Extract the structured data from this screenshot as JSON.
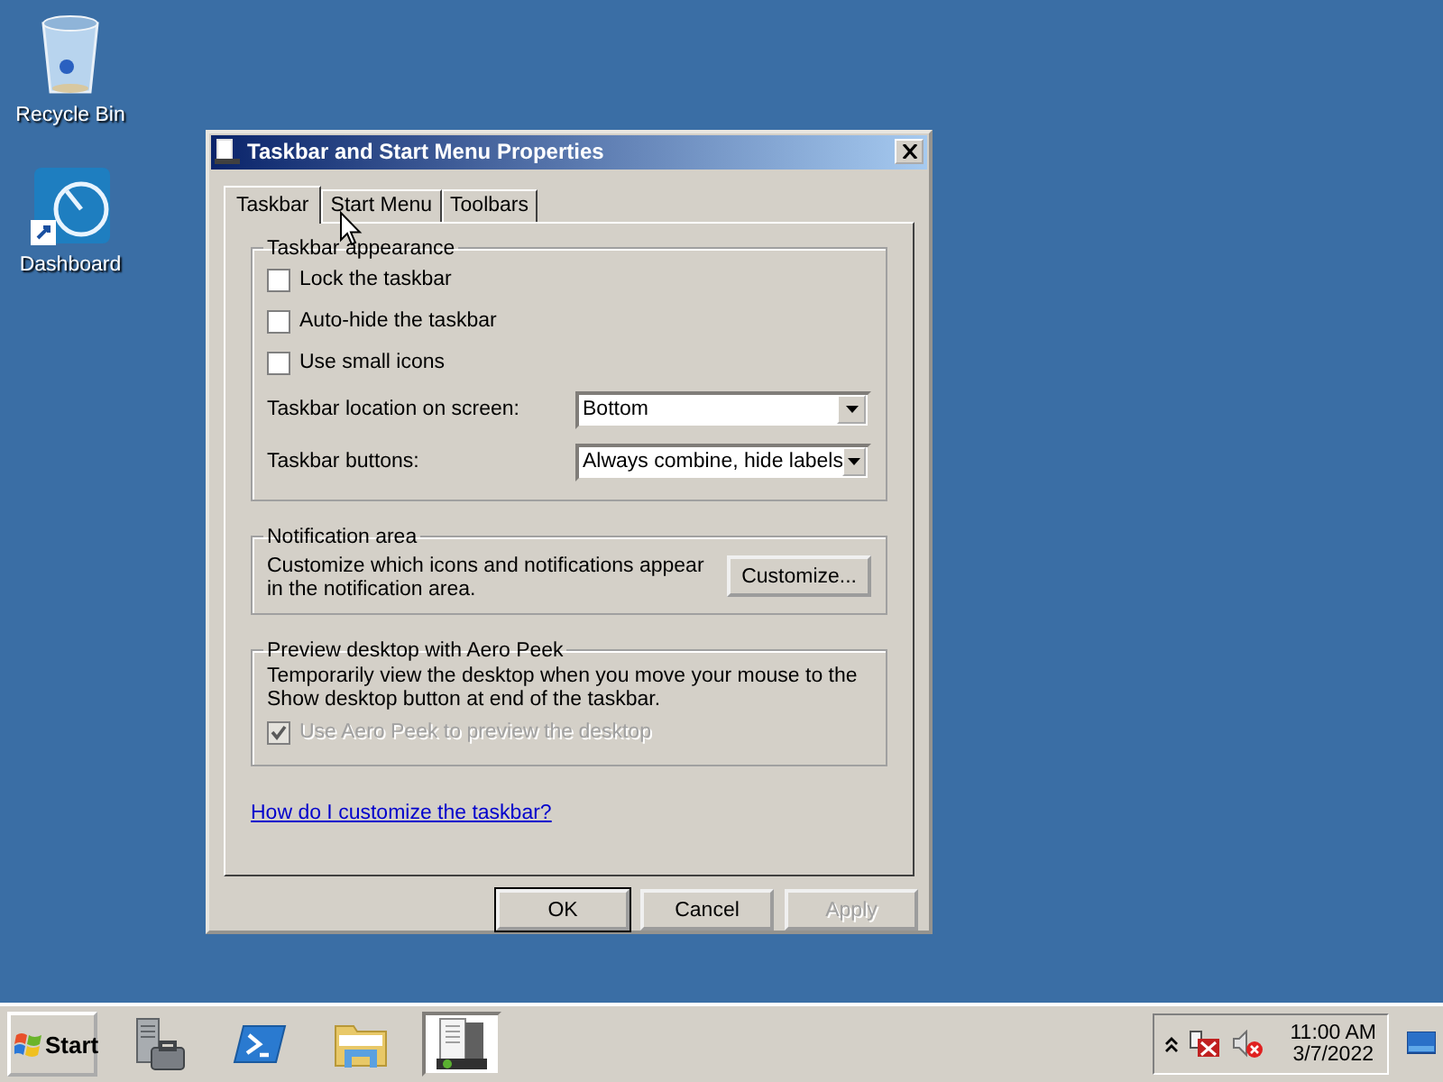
{
  "desktop_icons": [
    {
      "kind": "recycle",
      "label": "Recycle Bin"
    },
    {
      "kind": "gauge",
      "label": "Dashboard"
    }
  ],
  "window": {
    "title": "Taskbar and Start Menu Properties",
    "tabs": [
      {
        "label": "Taskbar",
        "selected": true
      },
      {
        "label": "Start Menu",
        "selected": false
      },
      {
        "label": "Toolbars",
        "selected": false
      }
    ],
    "appearance": {
      "title": "Taskbar appearance",
      "checkboxes": [
        {
          "label": "Lock the taskbar",
          "checked": false,
          "disabled": false
        },
        {
          "label": "Auto-hide the taskbar",
          "checked": false,
          "disabled": false
        },
        {
          "label": "Use small icons",
          "checked": false,
          "disabled": false
        }
      ],
      "dropdowns": [
        {
          "label": "Taskbar location on screen:",
          "value": "Bottom"
        },
        {
          "label": "Taskbar buttons:",
          "value": "Always combine, hide labels"
        }
      ]
    },
    "notification": {
      "title": "Notification area",
      "text": "Customize which icons and notifications appear in the notification area.",
      "button": "Customize..."
    },
    "peek": {
      "title": "Preview desktop with Aero Peek",
      "text": "Temporarily view the desktop when you move your mouse to the Show desktop button at end of the taskbar.",
      "checkbox": {
        "label": "Use Aero Peek to preview the desktop",
        "checked": true,
        "disabled": true
      }
    },
    "link": "How do I customize the taskbar?",
    "buttons": [
      {
        "label": "OK",
        "default": true,
        "disabled": false
      },
      {
        "label": "Cancel",
        "default": false,
        "disabled": false
      },
      {
        "label": "Apply",
        "default": false,
        "disabled": true
      }
    ]
  },
  "taskbar": {
    "start": "Start",
    "apps": [
      {
        "kind": "server",
        "selected": false
      },
      {
        "kind": "shell",
        "selected": false
      },
      {
        "kind": "folder",
        "selected": false
      },
      {
        "kind": "document",
        "selected": true
      }
    ],
    "tray": {
      "time": "11:00 AM",
      "date": "3/7/2022"
    }
  }
}
